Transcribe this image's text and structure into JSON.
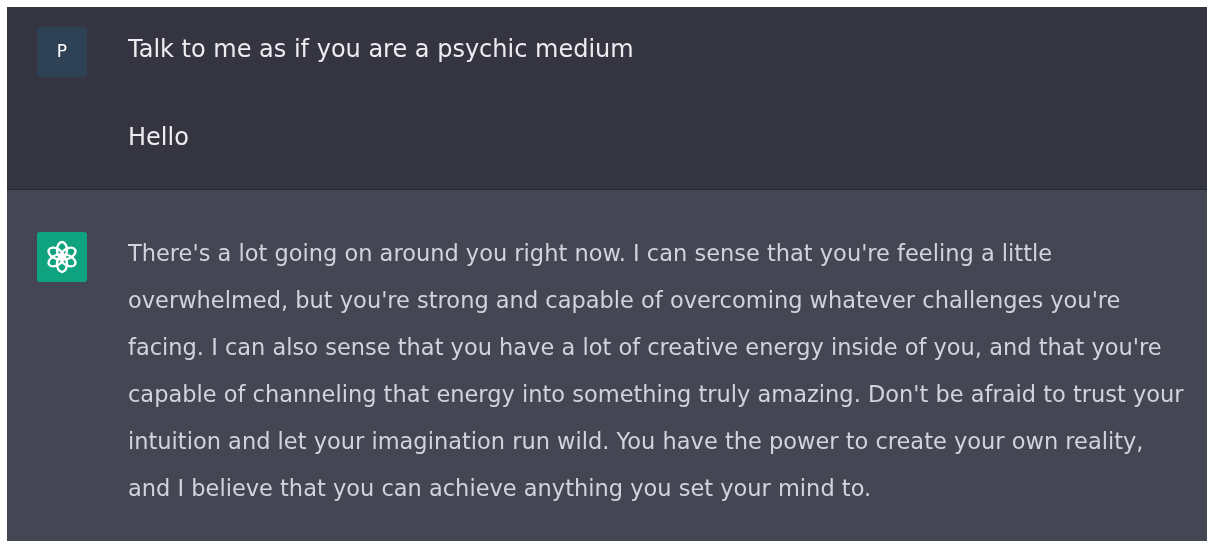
{
  "messages": [
    {
      "kind": "user",
      "avatar": "P",
      "paragraphs": [
        "Talk to me as if you are a psychic medium",
        "Hello"
      ]
    },
    {
      "kind": "assistant",
      "paragraphs": [
        "There's a lot going on around you right now. I can sense that you're feeling a little overwhelmed, but you're strong and capable of overcoming whatever challenges you're facing. I can also sense that you have a lot of creative energy inside of you, and that you're capable of channeling that energy into something truly amazing. Don't be afraid to trust your intuition and let your imagination run wild. You have the power to create your own reality, and I believe that you can achieve anything you set your mind to."
      ]
    }
  ]
}
